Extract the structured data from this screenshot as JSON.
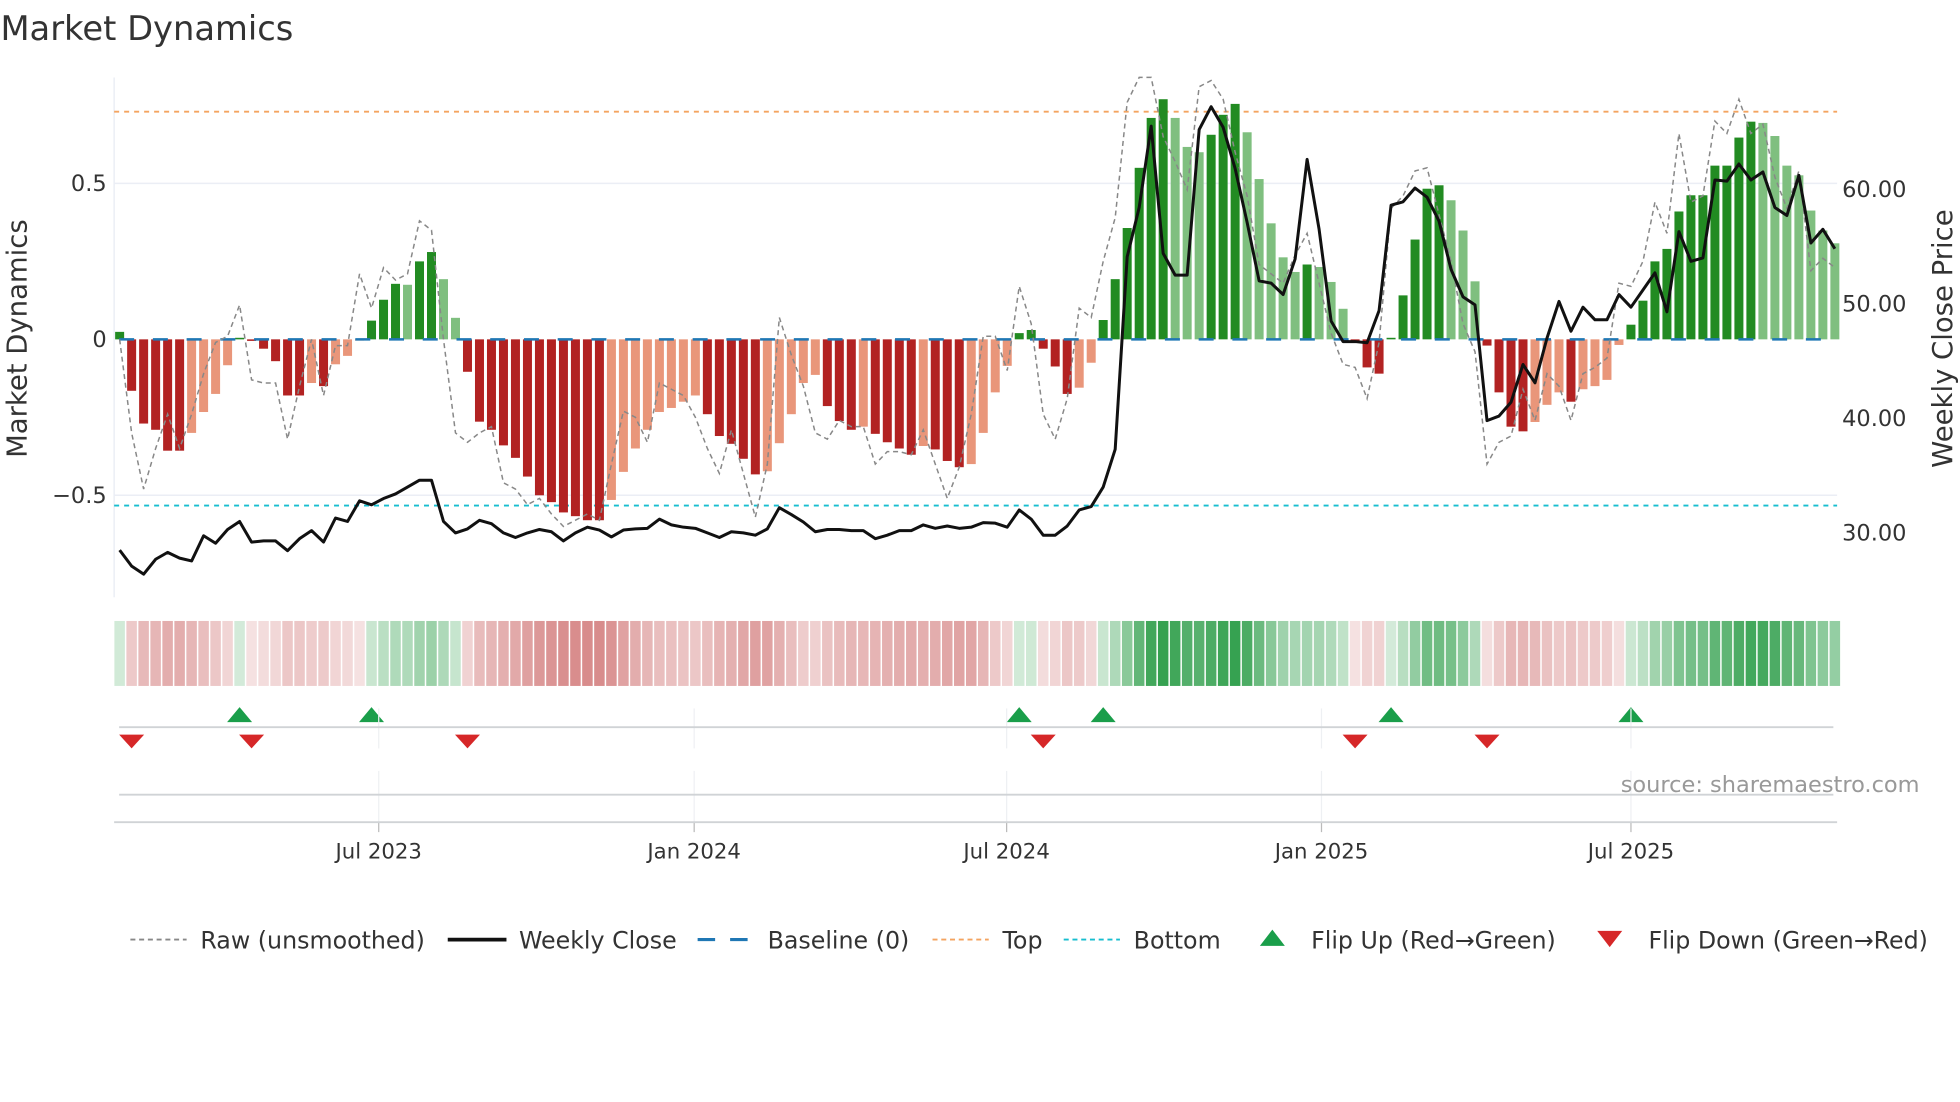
{
  "title": "Market Dynamics",
  "source": "source: sharemaestro.com",
  "colors": {
    "up_strong": "#228b22",
    "up_weak": "#7fbf7f",
    "down_strong": "#b22222",
    "down_weak": "#e9967a",
    "baseline": "#1f77b4",
    "top": "#f4a460",
    "bottom": "#17becf",
    "raw": "#888888",
    "close": "#111111",
    "flip_up": "#1a9e4a",
    "flip_down": "#d62728"
  },
  "chart_data": {
    "type": "bar",
    "title": "Market Dynamics",
    "ylabel": "Market Dynamics",
    "y2label": "Weekly Close Price",
    "ylim": [
      -0.83,
      0.84
    ],
    "y2lim": [
      23.5,
      65.9
    ],
    "yticks": [
      {
        "value": 0.5,
        "label": "0.5"
      },
      {
        "value": 0,
        "label": "0"
      },
      {
        "value": -0.5,
        "label": "−0.5"
      }
    ],
    "y2ticks": [
      {
        "value": 60,
        "label": "60.00"
      },
      {
        "value": 50,
        "label": "50.00"
      },
      {
        "value": 40,
        "label": "40.00"
      },
      {
        "value": 30,
        "label": "30.00"
      }
    ],
    "x_unit": "week index",
    "xticks": [
      {
        "week": 21.6,
        "label": "Jul 2023"
      },
      {
        "week": 47.9,
        "label": "Jan 2024"
      },
      {
        "week": 73.95,
        "label": "Jul 2024"
      },
      {
        "week": 100.2,
        "label": "Jan 2025"
      },
      {
        "week": 126.0,
        "label": "Jul 2025"
      }
    ],
    "top": 0.73,
    "bottom": -0.533,
    "baseline": 0,
    "grid": true,
    "legend_position": "bottom",
    "values": [
      0.024,
      -0.165,
      -0.27,
      -0.29,
      -0.357,
      -0.357,
      -0.3,
      -0.233,
      -0.175,
      -0.083,
      0.005,
      -0.005,
      -0.03,
      -0.07,
      -0.18,
      -0.18,
      -0.14,
      -0.15,
      -0.08,
      -0.053,
      -0.004,
      0.06,
      0.127,
      0.178,
      0.175,
      0.25,
      0.28,
      0.193,
      0.069,
      -0.104,
      -0.264,
      -0.29,
      -0.34,
      -0.38,
      -0.44,
      -0.5,
      -0.522,
      -0.555,
      -0.567,
      -0.58,
      -0.58,
      -0.515,
      -0.425,
      -0.35,
      -0.29,
      -0.233,
      -0.22,
      -0.2,
      -0.18,
      -0.24,
      -0.31,
      -0.335,
      -0.383,
      -0.433,
      -0.423,
      -0.333,
      -0.24,
      -0.14,
      -0.114,
      -0.214,
      -0.262,
      -0.29,
      -0.28,
      -0.303,
      -0.33,
      -0.35,
      -0.37,
      -0.342,
      -0.353,
      -0.39,
      -0.41,
      -0.4,
      -0.3,
      -0.17,
      -0.085,
      0.02,
      0.03,
      -0.03,
      -0.087,
      -0.175,
      -0.155,
      -0.075,
      0.062,
      0.193,
      0.357,
      0.55,
      0.71,
      0.77,
      0.71,
      0.617,
      0.6,
      0.656,
      0.72,
      0.755,
      0.664,
      0.514,
      0.372,
      0.263,
      0.216,
      0.24,
      0.232,
      0.184,
      0.098,
      -0.005,
      -0.09,
      -0.11,
      0.005,
      0.141,
      0.32,
      0.483,
      0.494,
      0.446,
      0.349,
      0.186,
      -0.02,
      -0.17,
      -0.28,
      -0.295,
      -0.265,
      -0.21,
      -0.17,
      -0.2,
      -0.16,
      -0.15,
      -0.13,
      -0.018,
      0.047,
      0.124,
      0.25,
      0.29,
      0.41,
      0.462,
      0.462,
      0.557,
      0.557,
      0.647,
      0.698,
      0.694,
      0.652,
      0.557,
      0.526,
      0.413,
      0.349,
      0.308
    ],
    "raw": [
      0.0,
      -0.3,
      -0.48,
      -0.35,
      -0.24,
      -0.35,
      -0.24,
      -0.11,
      -0.01,
      0.01,
      0.11,
      -0.13,
      -0.14,
      -0.14,
      -0.32,
      -0.15,
      0.0,
      -0.18,
      -0.02,
      -0.02,
      0.21,
      0.1,
      0.23,
      0.19,
      0.21,
      0.38,
      0.35,
      0.0,
      -0.3,
      -0.33,
      -0.3,
      -0.28,
      -0.46,
      -0.48,
      -0.53,
      -0.51,
      -0.56,
      -0.6,
      -0.58,
      -0.56,
      -0.58,
      -0.4,
      -0.23,
      -0.25,
      -0.33,
      -0.14,
      -0.16,
      -0.18,
      -0.25,
      -0.35,
      -0.43,
      -0.29,
      -0.43,
      -0.57,
      -0.4,
      0.07,
      -0.05,
      -0.15,
      -0.3,
      -0.32,
      -0.26,
      -0.28,
      -0.28,
      -0.4,
      -0.36,
      -0.36,
      -0.37,
      -0.29,
      -0.4,
      -0.51,
      -0.41,
      -0.24,
      0.01,
      0.01,
      -0.1,
      0.17,
      0.05,
      -0.24,
      -0.32,
      -0.19,
      0.1,
      0.07,
      0.25,
      0.39,
      0.76,
      0.84,
      0.84,
      0.65,
      0.57,
      0.48,
      0.81,
      0.83,
      0.77,
      0.6,
      0.46,
      0.24,
      0.21,
      0.18,
      0.27,
      0.34,
      0.18,
      0.02,
      -0.08,
      -0.09,
      -0.19,
      -0.01,
      0.42,
      0.46,
      0.54,
      0.55,
      0.4,
      0.25,
      0.05,
      -0.04,
      -0.4,
      -0.33,
      -0.31,
      -0.16,
      -0.26,
      -0.11,
      -0.15,
      -0.26,
      -0.11,
      -0.09,
      -0.06,
      0.18,
      0.17,
      0.25,
      0.44,
      0.34,
      0.66,
      0.44,
      0.46,
      0.7,
      0.66,
      0.77,
      0.66,
      0.69,
      0.52,
      0.42,
      0.54,
      0.22,
      0.26,
      0.23
    ],
    "close": [
      28.4,
      27.0,
      26.3,
      27.6,
      28.2,
      27.7,
      27.45,
      29.65,
      29.0,
      30.2,
      30.9,
      29.1,
      29.2,
      29.2,
      28.35,
      29.4,
      30.1,
      29.1,
      31.2,
      30.9,
      32.7,
      32.35,
      32.9,
      33.3,
      33.9,
      34.5,
      34.5,
      30.9,
      29.9,
      30.25,
      31.0,
      30.7,
      29.9,
      29.5,
      29.9,
      30.2,
      30.0,
      29.2,
      29.9,
      30.4,
      30.15,
      29.55,
      30.15,
      30.25,
      30.3,
      31.1,
      30.6,
      30.4,
      30.3,
      29.9,
      29.5,
      30.0,
      29.9,
      29.7,
      30.25,
      32.1,
      31.5,
      30.85,
      30.0,
      30.2,
      30.2,
      30.1,
      30.1,
      29.4,
      29.7,
      30.1,
      30.1,
      30.6,
      30.3,
      30.5,
      30.3,
      30.4,
      30.8,
      30.75,
      30.4,
      31.9,
      31.1,
      29.7,
      29.7,
      30.5,
      31.9,
      32.2,
      33.9,
      37.2,
      54.0,
      58.3,
      65.4,
      54.3,
      52.4,
      52.4,
      65.1,
      67.1,
      65.3,
      61.7,
      57.0,
      51.9,
      51.7,
      50.7,
      53.8,
      62.5,
      56.4,
      48.4,
      46.6,
      46.6,
      46.5,
      49.3,
      58.5,
      58.8,
      60.0,
      59.2,
      57.1,
      52.9,
      50.5,
      49.8,
      39.7,
      40.1,
      41.3,
      44.6,
      43.0,
      46.9,
      50.1,
      47.5,
      49.6,
      48.5,
      48.5,
      50.7,
      49.6,
      51.1,
      52.6,
      49.2,
      56.2,
      53.6,
      53.9,
      60.7,
      60.6,
      62.1,
      60.7,
      61.4,
      58.3,
      57.6,
      61.1,
      55.2,
      56.4,
      54.7
    ],
    "flip_up_weeks": [
      10,
      21,
      75,
      82,
      106,
      126
    ],
    "flip_down_weeks": [
      1,
      11,
      29,
      77,
      103,
      114
    ],
    "legend": [
      {
        "key": "raw",
        "label": "Raw (unsmoothed)"
      },
      {
        "key": "close",
        "label": "Weekly Close"
      },
      {
        "key": "baseline",
        "label": "Baseline (0)"
      },
      {
        "key": "top",
        "label": "Top"
      },
      {
        "key": "bottom",
        "label": "Bottom"
      },
      {
        "key": "flip_up",
        "label": "Flip Up (Red→Green)"
      },
      {
        "key": "flip_down",
        "label": "Flip Down (Green→Red)"
      }
    ]
  }
}
